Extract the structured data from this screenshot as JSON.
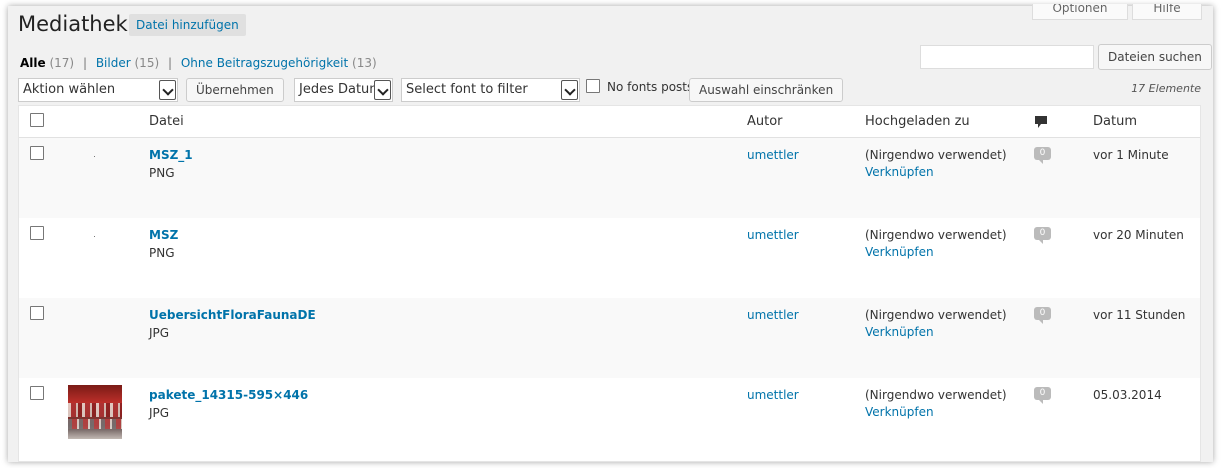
{
  "screen_options": {
    "options_label": "Optionen",
    "help_label": "Hilfe"
  },
  "header": {
    "title": "Mediathek",
    "add_new_label": "Datei hinzufügen"
  },
  "filters": {
    "all_label": "Alle",
    "all_count": "(17)",
    "images_label": "Bilder",
    "images_count": "(15)",
    "unattached_label": "Ohne Beitragszugehörigkeit",
    "unattached_count": "(13)",
    "separator": "|"
  },
  "search": {
    "value": "",
    "button_label": "Dateien suchen"
  },
  "toolbar": {
    "bulk_action_selected": "Aktion wählen",
    "apply_label": "Übernehmen",
    "date_selected": "Jedes Datum",
    "font_filter_selected": "Select font to filter",
    "no_fonts_label": "No fonts posts",
    "filter_label": "Auswahl einschränken",
    "items_count": "17 Elemente"
  },
  "table": {
    "headers": {
      "file": "Datei",
      "author": "Autor",
      "uploaded_to": "Hochgeladen zu",
      "comments_icon": "comment-bubble-icon",
      "date": "Datum"
    },
    "rows": [
      {
        "title": "MSZ_1",
        "type": "PNG",
        "author": "umettler",
        "uploaded": "(Nirgendwo verwendet)",
        "attach": "Verknüpfen",
        "comments": "0",
        "date": "vor 1 Minute"
      },
      {
        "title": "MSZ",
        "type": "PNG",
        "author": "umettler",
        "uploaded": "(Nirgendwo verwendet)",
        "attach": "Verknüpfen",
        "comments": "0",
        "date": "vor 20 Minuten"
      },
      {
        "title": "UebersichtFloraFaunaDE",
        "type": "JPG",
        "author": "umettler",
        "uploaded": "(Nirgendwo verwendet)",
        "attach": "Verknüpfen",
        "comments": "0",
        "date": "vor 11 Stunden"
      },
      {
        "title": "pakete_14315-595×446",
        "type": "JPG",
        "author": "umettler",
        "uploaded": "(Nirgendwo verwendet)",
        "attach": "Verknüpfen",
        "comments": "0",
        "date": "05.03.2014"
      }
    ]
  },
  "colors": {
    "link": "#0073aa",
    "background": "#f1f1f1",
    "row_alt": "#f9f9f9"
  }
}
